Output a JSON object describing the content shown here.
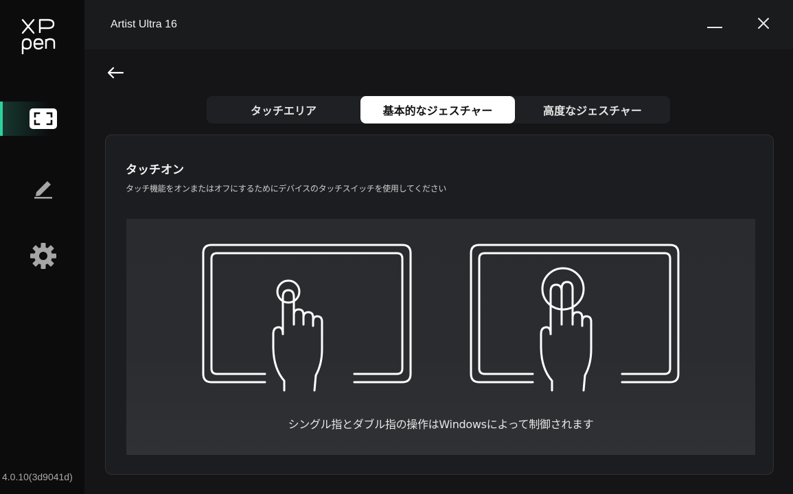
{
  "app": {
    "logo_text": "XP pen",
    "version": "4.0.10(3d9041d)"
  },
  "sidebar": {
    "items": [
      {
        "id": "touch-area",
        "icon": "screen-frame-icon",
        "active": true
      },
      {
        "id": "pen",
        "icon": "pen-icon",
        "active": false
      },
      {
        "id": "settings",
        "icon": "gear-icon",
        "active": false
      }
    ]
  },
  "titlebar": {
    "title": "Artist Ultra 16",
    "minimize_icon": "minimize-icon",
    "close_icon": "close-icon"
  },
  "main": {
    "back_icon": "back-arrow-icon",
    "tabs": [
      {
        "label": "タッチエリア",
        "active": false
      },
      {
        "label": "基本的なジェスチャー",
        "active": true
      },
      {
        "label": "高度なジェスチャー",
        "active": false
      }
    ],
    "card": {
      "title": "タッチオン",
      "description": "タッチ機能をオンまたはオフにするためにデバイスのタッチスイッチを使用してください",
      "illustration": {
        "left_icon": "single-finger-tap-icon",
        "right_icon": "double-finger-tap-icon",
        "caption": "シングル指とダブル指の操作はWindowsによって制御されます"
      }
    }
  },
  "colors": {
    "accent": "#2fd19a",
    "sidebar_bg": "#0c0c0d",
    "titlebar_bg": "#1a1b1d",
    "card_bg": "#1c1d20",
    "active_tab_bg": "#ffffff"
  }
}
